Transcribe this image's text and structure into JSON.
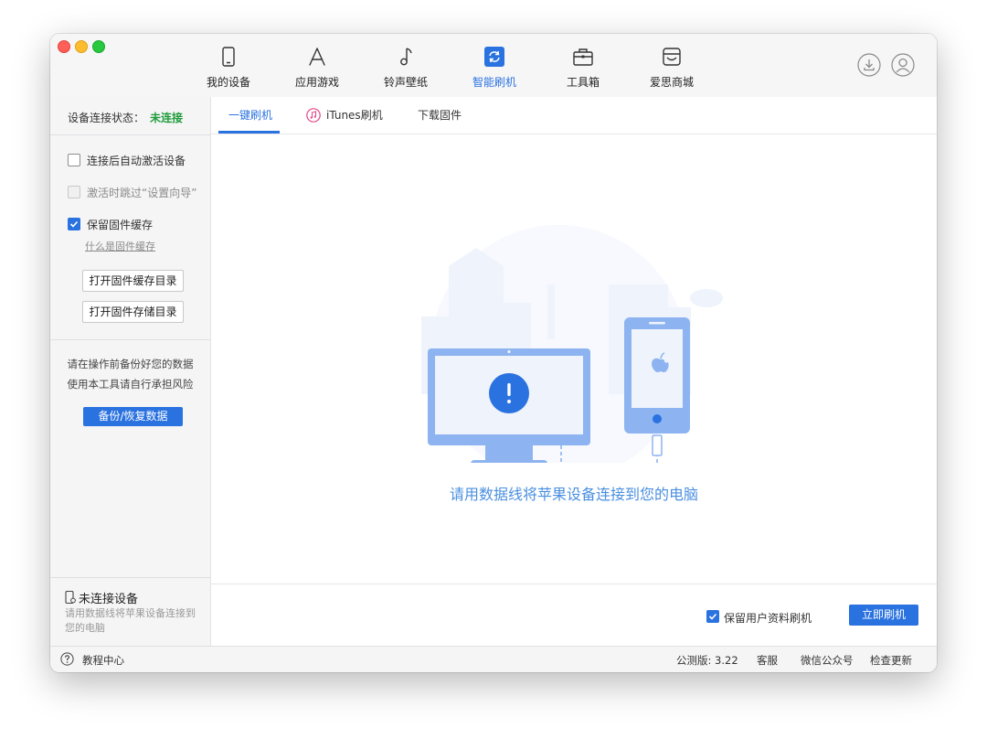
{
  "nav": {
    "items": [
      {
        "label": "我的设备",
        "icon": "phone-icon"
      },
      {
        "label": "应用游戏",
        "icon": "app-store-icon"
      },
      {
        "label": "铃声壁纸",
        "icon": "music-note-icon"
      },
      {
        "label": "智能刷机",
        "icon": "refresh-icon",
        "active": true
      },
      {
        "label": "工具箱",
        "icon": "toolbox-icon"
      },
      {
        "label": "爱思商城",
        "icon": "store-icon"
      }
    ],
    "right_icons": [
      "download-icon",
      "user-avatar-icon"
    ]
  },
  "sidebar": {
    "status_label": "设备连接状态：",
    "status_value": "未连接",
    "options": [
      {
        "label": "连接后自动激活设备",
        "checked": false,
        "disabled": false
      },
      {
        "label": "激活时跳过“设置向导”",
        "checked": false,
        "disabled": true
      },
      {
        "label": "保留固件缓存",
        "checked": true,
        "disabled": false
      }
    ],
    "firmware_cache_link": "什么是固件缓存",
    "open_cache_dir_btn": "打开固件缓存目录",
    "open_storage_dir_btn": "打开固件存储目录",
    "warning_line1": "请在操作前备份好您的数据",
    "warning_line2": "使用本工具请自行承担风险",
    "backup_btn": "备份/恢复数据",
    "device_title": "未连接设备",
    "device_desc": "请用数据线将苹果设备连接到您的电脑"
  },
  "tabs": [
    {
      "label": "一键刷机",
      "active": true
    },
    {
      "label": "iTunes刷机",
      "icon": "itunes-icon"
    },
    {
      "label": "下载固件"
    }
  ],
  "main": {
    "connect_message": "请用数据线将苹果设备连接到您的电脑",
    "keep_data_label": "保留用户资料刷机",
    "keep_data_checked": true,
    "flash_button": "立即刷机"
  },
  "statusbar": {
    "help_label": "教程中心",
    "version": "公测版: 3.22",
    "support": "客服",
    "wechat": "微信公众号",
    "update": "检查更新"
  },
  "colors": {
    "accent": "#2a72e0",
    "connected_status": "#1f9c3a",
    "illustration_blue": "#8db4f0"
  }
}
